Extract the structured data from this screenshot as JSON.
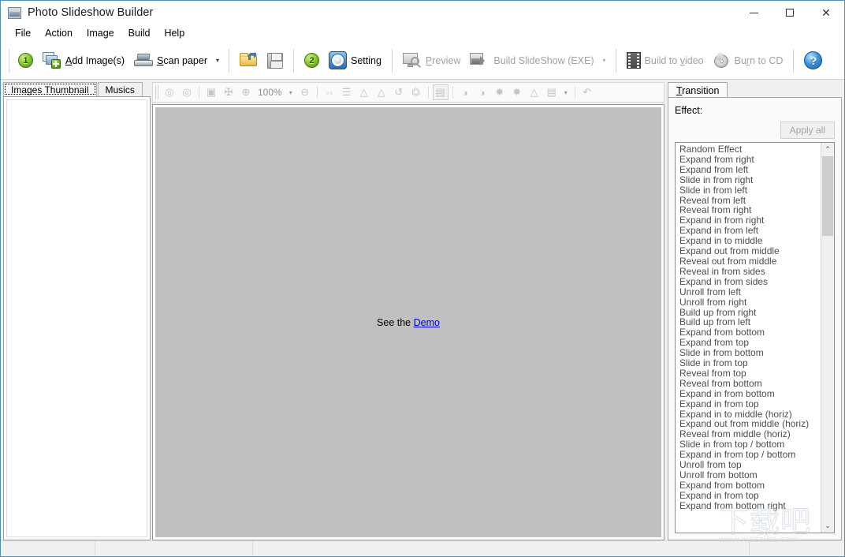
{
  "window": {
    "title": "Photo Slideshow Builder",
    "icon": "app-photo-icon",
    "controls": {
      "minimize": "–",
      "maximize": "□",
      "close": "✕"
    }
  },
  "menu": {
    "items": [
      {
        "label": "File"
      },
      {
        "label": "Action"
      },
      {
        "label": "Image"
      },
      {
        "label": "Build"
      },
      {
        "label": "Help"
      }
    ]
  },
  "toolbar": {
    "step1_badge": "1",
    "add_images_label": "Add Image(s)",
    "add_images_accel": "A",
    "scan_paper_label": "Scan paper",
    "scan_paper_accel": "S",
    "open_label": "",
    "save_label": "",
    "step2_badge": "2",
    "setting_label": "Setting",
    "preview_label": "Preview",
    "preview_accel": "P",
    "build_slideshow_label": "Build SlideShow (EXE)",
    "build_video_label": "Build to video",
    "build_video_accel": "v",
    "burn_cd_label": "Burn to CD",
    "burn_cd_accel": "r",
    "help_label": "?",
    "dropdown_caret": "▾"
  },
  "left_panel": {
    "tabs": [
      {
        "label": "Images Thumbnail",
        "active": true
      },
      {
        "label": "Musics",
        "active": false
      }
    ],
    "thumbnail_list": []
  },
  "image_toolbar": {
    "zoom_value": "100%",
    "caret": "▾",
    "buttons": [
      {
        "name": "first-image-icon"
      },
      {
        "name": "last-image-icon"
      },
      {
        "name": "fit-to-window-icon"
      },
      {
        "name": "actual-size-icon"
      },
      {
        "name": "zoom-in-icon"
      },
      {
        "name": "zoom-out-icon"
      },
      {
        "name": "flip-horizontal-icon"
      },
      {
        "name": "flip-vertical-icon"
      },
      {
        "name": "rotate-left-icon"
      },
      {
        "name": "rotate-right-icon"
      },
      {
        "name": "rotate-free-icon"
      },
      {
        "name": "crop-icon"
      },
      {
        "name": "resize-icon"
      },
      {
        "name": "contrast-up-icon"
      },
      {
        "name": "contrast-down-icon"
      },
      {
        "name": "brightness-up-icon"
      },
      {
        "name": "brightness-down-icon"
      },
      {
        "name": "sharpen-icon"
      },
      {
        "name": "color-adjust-icon"
      },
      {
        "name": "undo-icon"
      }
    ]
  },
  "canvas": {
    "see_the_text": "See the",
    "demo_link": "Demo"
  },
  "right_panel": {
    "tab_label": "Transition",
    "tab_accel": "T",
    "effect_label": "Effect:",
    "apply_all_label": "Apply all",
    "scroll_up": "⌃",
    "scroll_down": "⌄",
    "effects": [
      "Random Effect",
      "Expand from right",
      "Expand from left",
      "Slide in from right",
      "Slide in from left",
      "Reveal from left",
      "Reveal from right",
      "Expand in from right",
      "Expand in from left",
      "Expand in to middle",
      "Expand out from middle",
      "Reveal out from middle",
      "Reveal in from sides",
      "Expand in from sides",
      "Unroll from left",
      "Unroll from right",
      "Build up from right",
      "Build up from left",
      "Expand from bottom",
      "Expand from top",
      "Slide in from bottom",
      "Slide in from top",
      "Reveal from top",
      "Reveal from bottom",
      "Expand in from bottom",
      "Expand in from top",
      "Expand in to middle (horiz)",
      "Expand out from middle (horiz)",
      "Reveal from middle (horiz)",
      "Slide in from top / bottom",
      "Expand in from top / bottom",
      "Unroll from top",
      "Unroll from bottom",
      "Expand from bottom",
      "Expand in from top",
      "Expand from bottom right"
    ]
  },
  "statusbar": {
    "cells": [
      "",
      "",
      "",
      ""
    ]
  },
  "watermark": {
    "cjk": "下载吧",
    "url": "www.xiazaiba.com"
  },
  "colors": {
    "window_border": "#4a93b8",
    "canvas_bg": "#c0c0c0",
    "link": "#0000cd",
    "disabled_text": "#a0a0a0"
  }
}
